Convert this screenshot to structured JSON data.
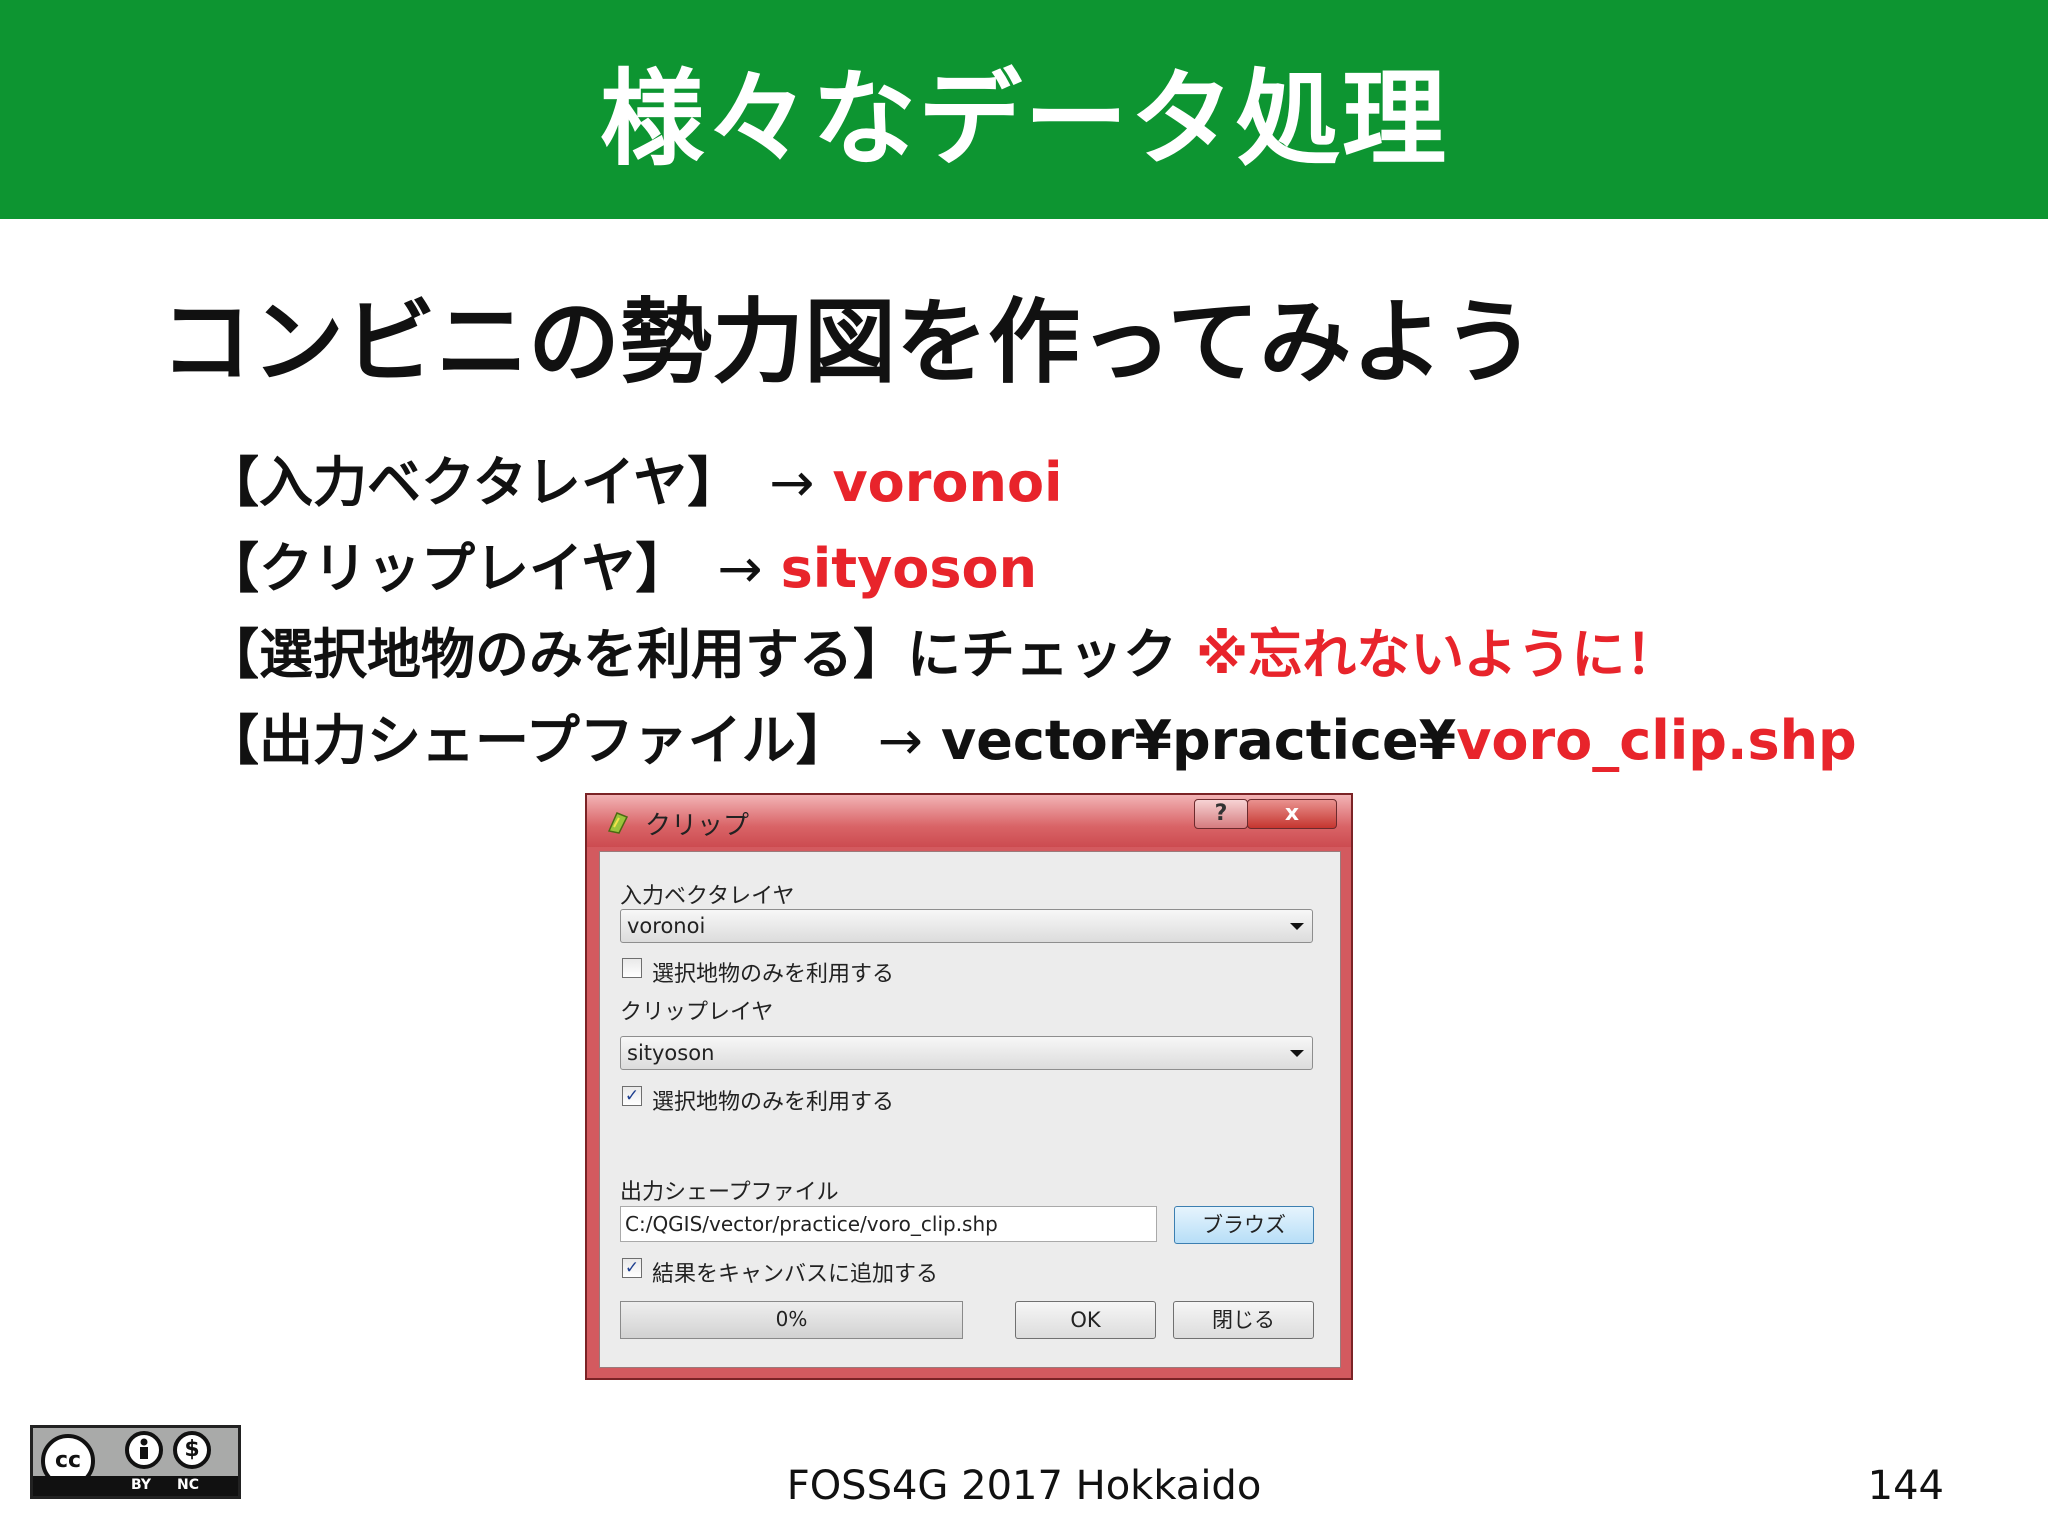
{
  "slide": {
    "title": "様々なデータ処理",
    "subtitle": "コンビニの勢力図を作ってみよう",
    "steps": [
      {
        "text": "【入力ベクタレイヤ】",
        "arrow": "→",
        "value": "voronoi"
      },
      {
        "text": "【クリップレイヤ】",
        "arrow": "→",
        "value": "sityoson"
      },
      {
        "text": "【選択地物のみを利用する】にチェック ",
        "note": "※忘れないように！"
      },
      {
        "text": "【出力シェープファイル】",
        "arrow": "→",
        "path_prefix": "vector¥practice¥",
        "path_file": "voro_clip.shp"
      }
    ]
  },
  "dialog": {
    "title": "クリップ",
    "help_label": "?",
    "close_label": "x",
    "input_layer_label": "入力ベクタレイヤ",
    "input_layer_value": "voronoi",
    "input_selected_only": {
      "label": "選択地物のみを利用する",
      "checked": false,
      "mark": ""
    },
    "clip_layer_label": "クリップレイヤ",
    "clip_layer_value": "sityoson",
    "clip_selected_only": {
      "label": "選択地物のみを利用する",
      "checked": true,
      "mark": "✓"
    },
    "output_label": "出力シェープファイル",
    "output_path": "C:/QGIS/vector/practice/voro_clip.shp",
    "browse_label": "ブラウズ",
    "add_to_canvas": {
      "label": "結果をキャンバスに追加する",
      "checked": true,
      "mark": "✓"
    },
    "progress": {
      "text": "0%",
      "value": 0
    },
    "ok_label": "OK",
    "close_button_label": "閉じる"
  },
  "footer": {
    "event": "FOSS4G 2017 Hokkaido",
    "page": "144",
    "license": {
      "cc": "cc",
      "by": "BY",
      "nc": "NC"
    }
  },
  "colors": {
    "banner": "#0d9531",
    "accent_red": "#e8242b",
    "dialog_frame": "#d35a5f"
  }
}
